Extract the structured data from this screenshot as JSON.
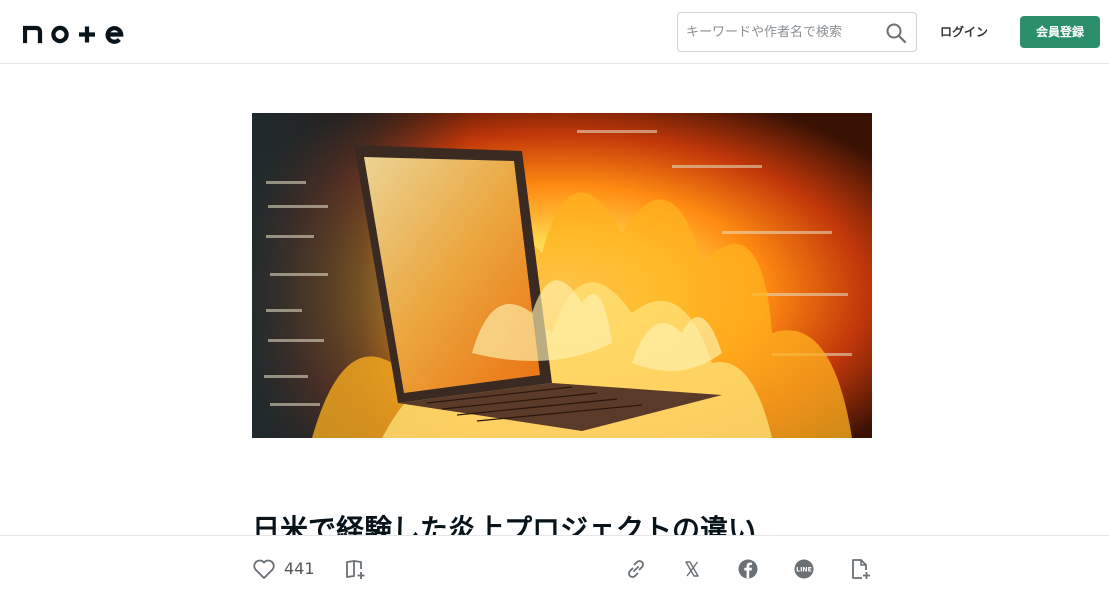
{
  "header": {
    "logo_text": "note",
    "search": {
      "placeholder": "キーワードや作者名で検索"
    },
    "login_label": "ログイン",
    "signup_label": "会員登録",
    "signup_color": "#2b8f6b"
  },
  "article": {
    "hero_image": "laptop-on-fire-image",
    "title": "日米で経験した炎上プロジェクトの違い"
  },
  "actions": {
    "like_count": "441",
    "icons": [
      "heart-icon",
      "add-to-magazine-icon",
      "link-icon",
      "x-icon",
      "facebook-icon",
      "line-icon",
      "note-add-icon"
    ]
  }
}
